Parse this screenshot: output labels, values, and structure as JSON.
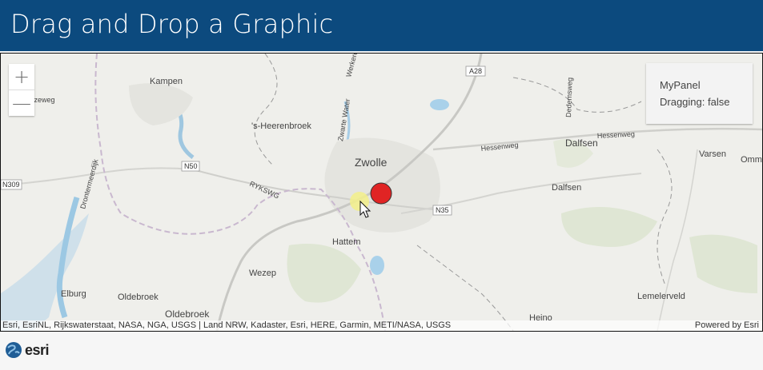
{
  "header": {
    "title": "Drag and Drop a Graphic"
  },
  "zoom": {
    "in_label": "+",
    "out_label": "—"
  },
  "panel": {
    "title": "MyPanel",
    "status": "Dragging: false"
  },
  "map": {
    "places": [
      "Kampen",
      "'s-Heerenbroek",
      "Zwolle",
      "Hattem",
      "Wezep",
      "Elburg",
      "Oldebroek",
      "Oldebroek",
      "Dalfsen",
      "Dalfsen",
      "Varsen",
      "Omm",
      "Heino",
      "Lemelerveld",
      "Hanzeweg",
      "Drontermeerdijk",
      "Werkeren",
      "Zwarte Water",
      "Dedemsweg"
    ],
    "roads": [
      "A28",
      "N50",
      "N309",
      "N35",
      "RYKSWG",
      "Hessenweg",
      "Hessenweg"
    ],
    "graphic_color": "#e02424"
  },
  "attribution": {
    "left": "Esri, EsriNL, Rijkswaterstaat, NASA, NGA, USGS | Land NRW, Kadaster, Esri, HERE, Garmin, METI/NASA, USGS",
    "right": "Powered by Esri"
  },
  "footer": {
    "logo_text": "esri"
  }
}
